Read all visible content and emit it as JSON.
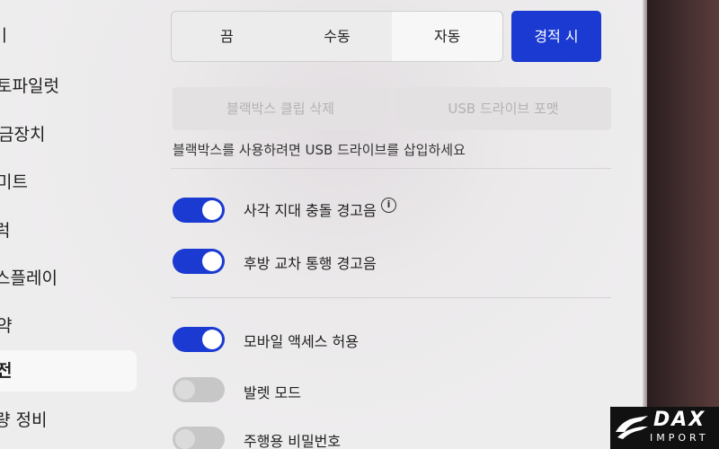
{
  "sidebar": {
    "items": [
      {
        "label": "ㅣ"
      },
      {
        "label": "토파일럿"
      },
      {
        "label": "금장치"
      },
      {
        "label": "미트"
      },
      {
        "label": "럭"
      },
      {
        "label": "스플레이"
      },
      {
        "label": "약"
      },
      {
        "label": "전"
      },
      {
        "label": "량 정비"
      }
    ],
    "active_index": 7
  },
  "recording_mode": {
    "options": [
      "끔",
      "수동",
      "자동"
    ],
    "selected": "자동",
    "cta_label": "경적 시"
  },
  "dashcam": {
    "delete_clips_label": "블랙박스 클립 삭제",
    "format_usb_label": "USB 드라이브 포맷",
    "hint": "블랙박스를 사용하려면 USB 드라이브를 삽입하세요"
  },
  "toggles": [
    {
      "label": "사각 지대 충돌 경고음",
      "on": true,
      "info": true
    },
    {
      "label": "후방 교차 통행 경고음",
      "on": true
    },
    {
      "label": "모바일 액세스 허용",
      "on": true
    },
    {
      "label": "발렛 모드",
      "on": false
    },
    {
      "label": "주행용 비밀번호",
      "on": false
    }
  ],
  "watermark": {
    "brand": "DAX",
    "sub": "IMPORT"
  },
  "colors": {
    "accent": "#1a3ad1",
    "toggle_off": "#c8c7c8",
    "background": "#ecebec"
  }
}
